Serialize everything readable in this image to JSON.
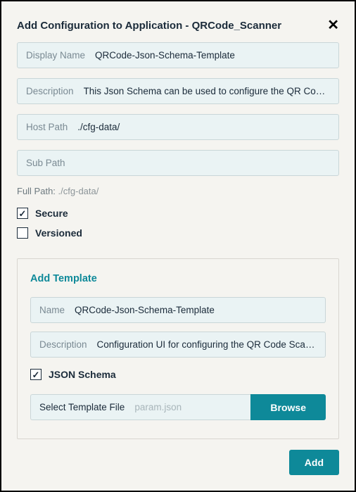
{
  "dialog": {
    "title": "Add Configuration to Application - QRCode_Scanner"
  },
  "fields": {
    "displayName": {
      "label": "Display Name",
      "value": "QRCode-Json-Schema-Template"
    },
    "description": {
      "label": "Description",
      "value": "This Json Schema can be used to configure the QR Code …"
    },
    "hostPath": {
      "label": "Host Path",
      "value": "./cfg-data/"
    },
    "subPath": {
      "label": "Sub Path",
      "value": ""
    }
  },
  "fullPath": {
    "label": "Full Path:",
    "value": "./cfg-data/"
  },
  "checks": {
    "secure": "Secure",
    "versioned": "Versioned"
  },
  "template": {
    "title": "Add Template",
    "name": {
      "label": "Name",
      "value": "QRCode-Json-Schema-Template"
    },
    "description": {
      "label": "Description",
      "value": "Configuration UI for configuring the QR Code Scann…"
    },
    "jsonSchema": "JSON Schema",
    "fileLabel": "Select Template File",
    "filePlaceholder": "param.json",
    "browse": "Browse"
  },
  "footer": {
    "add": "Add"
  }
}
